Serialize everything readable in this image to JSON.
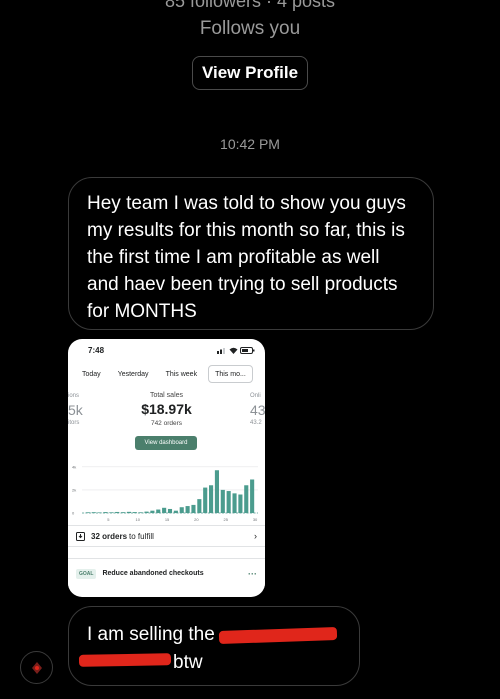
{
  "profile": {
    "stats": "85 followers · 4 posts",
    "follows_you": "Follows you",
    "view_profile_label": "View Profile"
  },
  "thread": {
    "timestamp": "10:42 PM",
    "message_1": "Hey team I was told to show you guys my results for this month so far, this is the first time I am profitable as well and haev been trying to sell products for MONTHS",
    "message_2_start": "I am selling the",
    "message_2_end": "btw"
  },
  "screenshot": {
    "status_time": "7:48",
    "tabs": [
      "Today",
      "Yesterday",
      "This week",
      "This mo..."
    ],
    "active_tab": 3,
    "left_label": "ions",
    "left_value": "5k",
    "left_sub": "itors",
    "total_sales_label": "Total sales",
    "total_sales_value": "$18.97k",
    "orders_count": "742 orders",
    "right_label": "Onli",
    "right_value": "43",
    "right_sub": "43.2",
    "view_dashboard_label": "View dashboard",
    "fulfill_count": "32 orders",
    "fulfill_rest": "to fulfill",
    "goal_tag": "GOAL",
    "goal_text": "Reduce abandoned checkouts",
    "accent_color": "#4b7f6c"
  },
  "chart_data": {
    "type": "bar",
    "ytick_labels": [
      "4k",
      "2k",
      "0"
    ],
    "xtick_labels": [
      "5",
      "10",
      "15",
      "20",
      "25",
      "30"
    ],
    "ylim": [
      0,
      4500
    ],
    "x": [
      1,
      2,
      3,
      4,
      5,
      6,
      7,
      8,
      9,
      10,
      11,
      12,
      13,
      14,
      15,
      16,
      17,
      18,
      19,
      20,
      21,
      22,
      23,
      24,
      25,
      26,
      27,
      28,
      29
    ],
    "values": [
      60,
      70,
      50,
      80,
      60,
      90,
      70,
      100,
      80,
      60,
      120,
      200,
      300,
      450,
      350,
      200,
      500,
      600,
      700,
      1200,
      2200,
      2400,
      3700,
      2000,
      1900,
      1700,
      1600,
      2400,
      2900
    ],
    "color": "#4b9c8e"
  }
}
